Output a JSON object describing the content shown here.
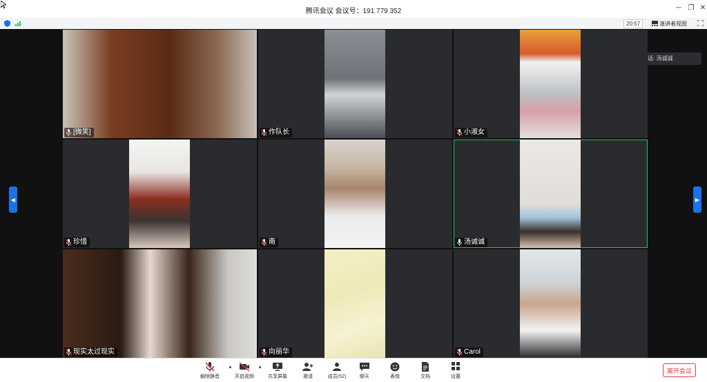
{
  "window": {
    "title": "腾讯会议 会议号：191 779 352"
  },
  "infobar": {
    "time": "20:57",
    "view_mode": "演讲者视图"
  },
  "speaking": {
    "label": "正在讲话: 汤诚诚"
  },
  "participants": [
    {
      "name": "[微笑]"
    },
    {
      "name": "作队长"
    },
    {
      "name": "小淑女"
    },
    {
      "name": "珍惜"
    },
    {
      "name": "南"
    },
    {
      "name": "汤诚诚"
    },
    {
      "name": "现实太过现实"
    },
    {
      "name": "向丽华"
    },
    {
      "name": "Carol"
    }
  ],
  "toolbar": {
    "unmute": "解除静音",
    "start_video": "开启视频",
    "share_screen": "共享屏幕",
    "invite": "邀请",
    "members": "成员(52)",
    "chat": "聊天",
    "emoji": "表情",
    "docs": "文档",
    "settings": "设置",
    "leave": "离开会议"
  },
  "colors": {
    "accent": "#1a73e8",
    "active_speaker_border": "#22c55e",
    "leave": "#e53935"
  }
}
